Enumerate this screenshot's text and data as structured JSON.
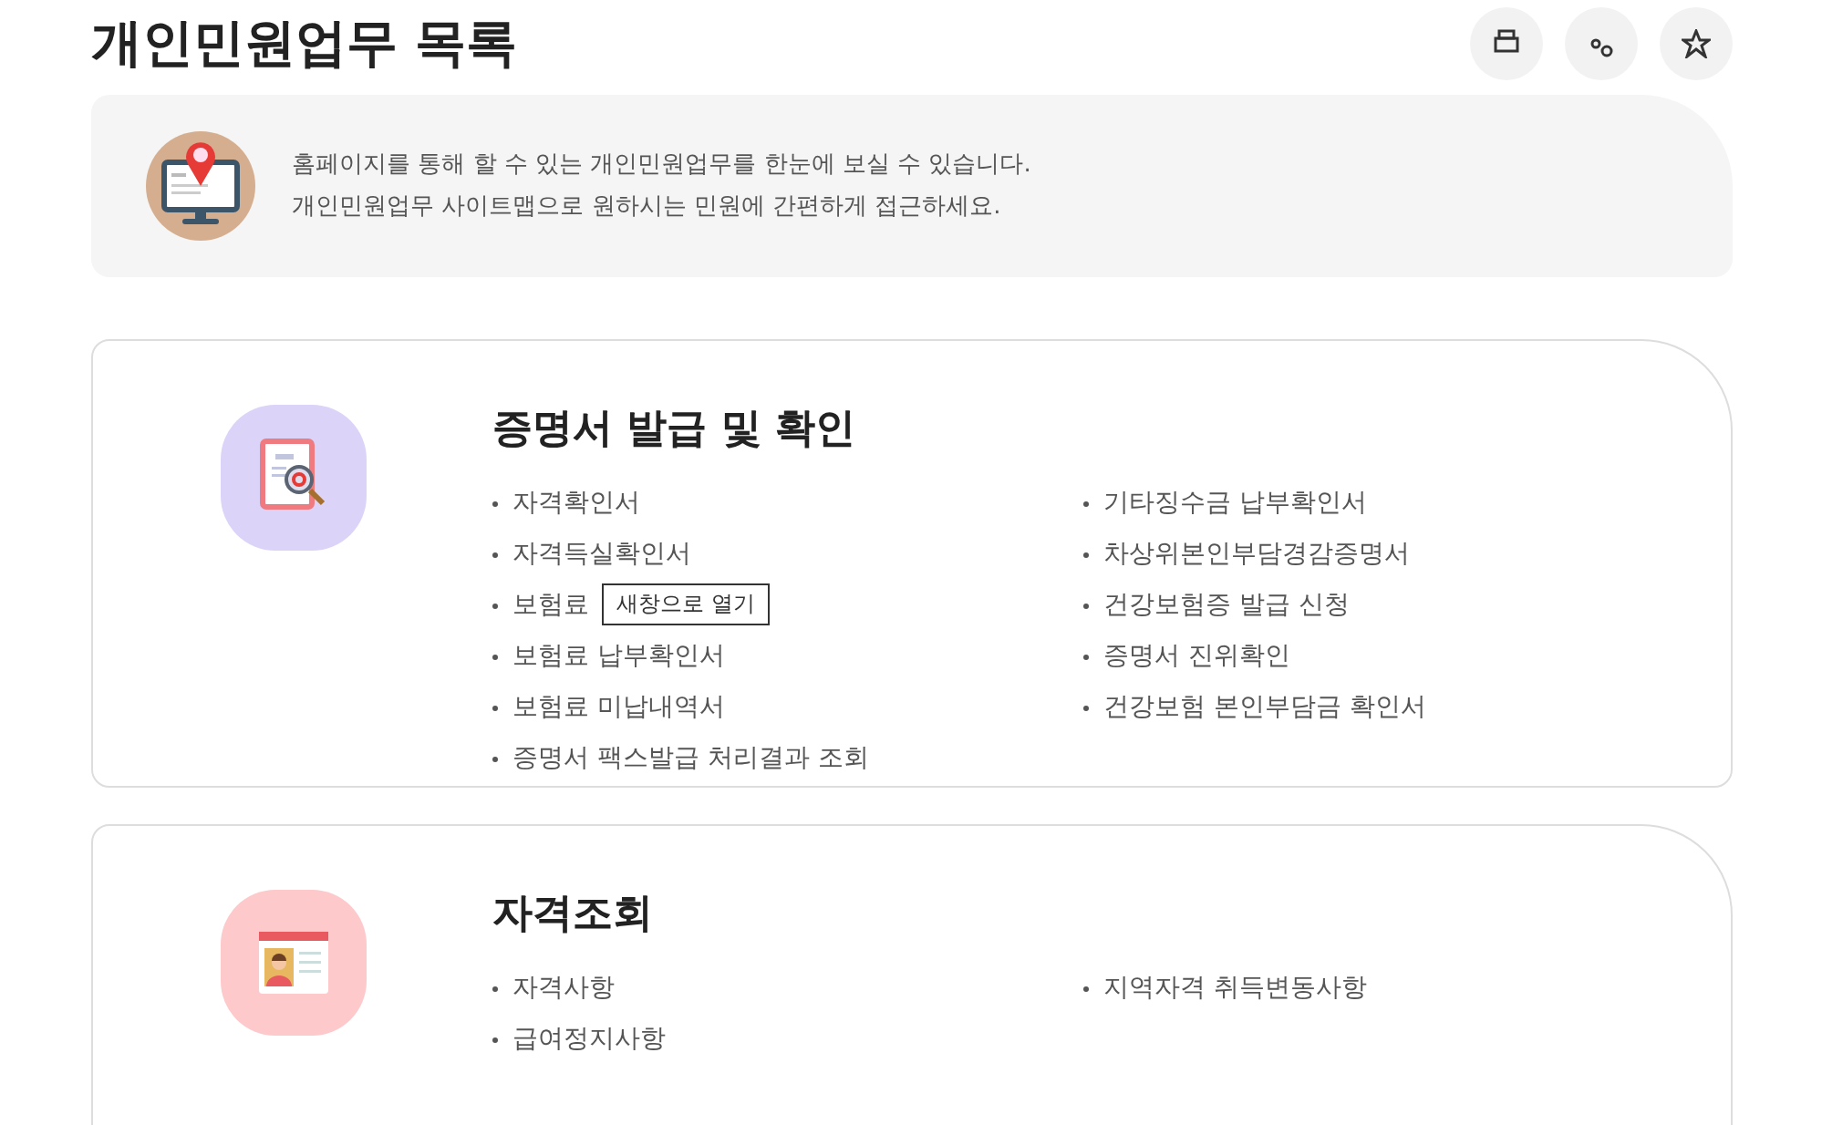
{
  "page_title": "개인민원업무 목록",
  "notice": {
    "lines": [
      "홈페이지를 통해 할 수 있는 개인민원업무를 한눈에 보실 수 있습니다.",
      "개인민원업무 사이트맵으로 원하시는 민원에 간편하게 접근하세요."
    ]
  },
  "sections": [
    {
      "kind": "certificate",
      "title": "증명서 발급 및 확인",
      "columns": [
        [
          "자격확인서",
          "자격득실확인서",
          "보험료",
          "보험료 납부확인서",
          "보험료 미납내역서",
          "증명서 팩스발급 처리결과 조회"
        ],
        [
          "기타징수금 납부확인서",
          "차상위본인부담경감증명서",
          "건강보험증 발급 신청",
          "증명서 진위확인",
          "건강보험 본인부담금 확인서"
        ]
      ]
    },
    {
      "kind": "id_card",
      "title": "자격조회",
      "columns": [
        [
          "자격사항",
          "급여정지사항"
        ],
        [
          "지역자격 취득변동사항"
        ]
      ]
    }
  ],
  "tooltip": {
    "text": "새창으로 열기"
  }
}
